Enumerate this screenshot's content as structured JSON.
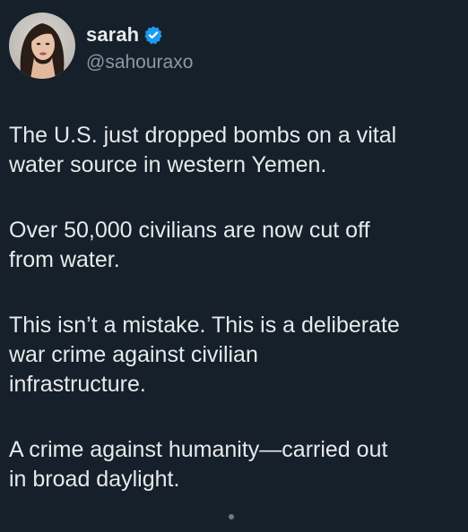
{
  "user": {
    "display_name": "sarah",
    "handle": "@sahouraxo",
    "verified": true
  },
  "tweet": {
    "paragraphs": [
      "The U.S. just dropped bombs on a vital\nwater source in western Yemen.",
      "Over 50,000 civilians are now cut off\nfrom water.",
      "This isn’t a mistake. This is a deliberate\nwar crime against civilian\ninfrastructure.",
      "A crime against humanity—carried out\nin broad daylight."
    ]
  },
  "colors": {
    "background": "#15202b",
    "text": "#e7e9ea",
    "secondary_text": "#8b98a5",
    "verified_badge": "#1d9bf0"
  },
  "icons": {
    "verified": "verified-badge-icon",
    "avatar": "profile-avatar"
  }
}
